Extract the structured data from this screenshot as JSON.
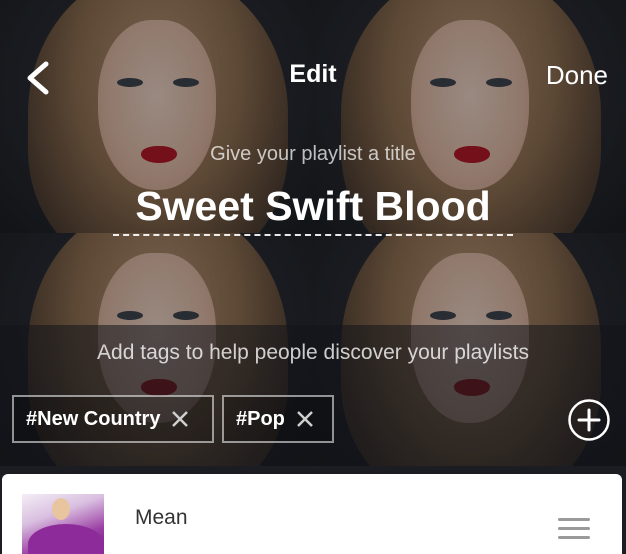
{
  "header": {
    "back_icon": "chevron-left-icon",
    "title": "Edit",
    "done_label": "Done"
  },
  "playlist": {
    "title_hint": "Give your playlist a title",
    "title": "Sweet Swift Blood"
  },
  "tags": {
    "hint": "Add tags to help people discover your playlists",
    "items": [
      {
        "label": "#New Country"
      },
      {
        "label": "#Pop"
      }
    ],
    "add_icon": "plus-circle-icon",
    "remove_icon": "close-icon"
  },
  "songs": [
    {
      "title": "Mean"
    }
  ],
  "colors": {
    "accent_lips": "#b3121f",
    "text": "#ffffff",
    "card": "#ffffff"
  }
}
